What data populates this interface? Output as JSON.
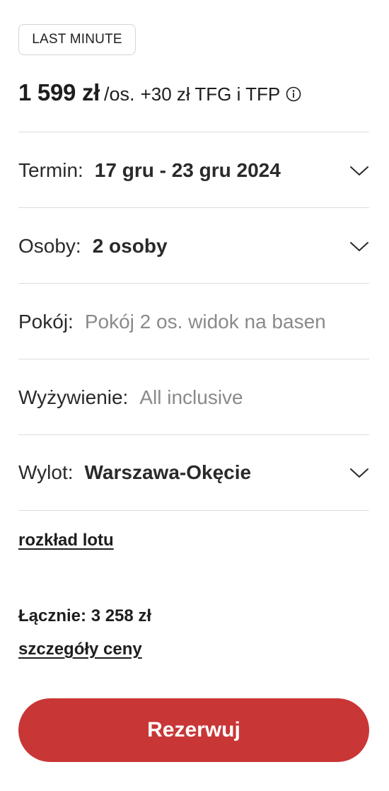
{
  "badge": {
    "label": "LAST MINUTE"
  },
  "price": {
    "amount": "1 599 zł",
    "per": "/os.",
    "extra": "+30 zł TFG i TFP"
  },
  "rows": [
    {
      "label": "Termin:",
      "value": "17 gru - 23 gru 2024",
      "has_dropdown": true
    },
    {
      "label": "Osoby:",
      "value": "2 osoby",
      "has_dropdown": true
    },
    {
      "label": "Pokój:",
      "value": "Pokój 2 os. widok na basen",
      "has_dropdown": false
    },
    {
      "label": "Wyżywienie:",
      "value": "All inclusive",
      "has_dropdown": false
    },
    {
      "label": "Wylot:",
      "value": "Warszawa-Okęcie",
      "has_dropdown": true
    }
  ],
  "links": {
    "flight_schedule": "rozkład lotu",
    "price_details": "szczegóły ceny"
  },
  "total": "Łącznie: 3 258 zł",
  "cta": {
    "label": "Rezerwuj"
  },
  "colors": {
    "accent": "#c93636",
    "text": "#222222",
    "muted": "#8a8a8a",
    "divider": "#dddddd"
  },
  "icons": {
    "info": "info-circle-icon",
    "dropdown": "chevron-down-icon"
  }
}
